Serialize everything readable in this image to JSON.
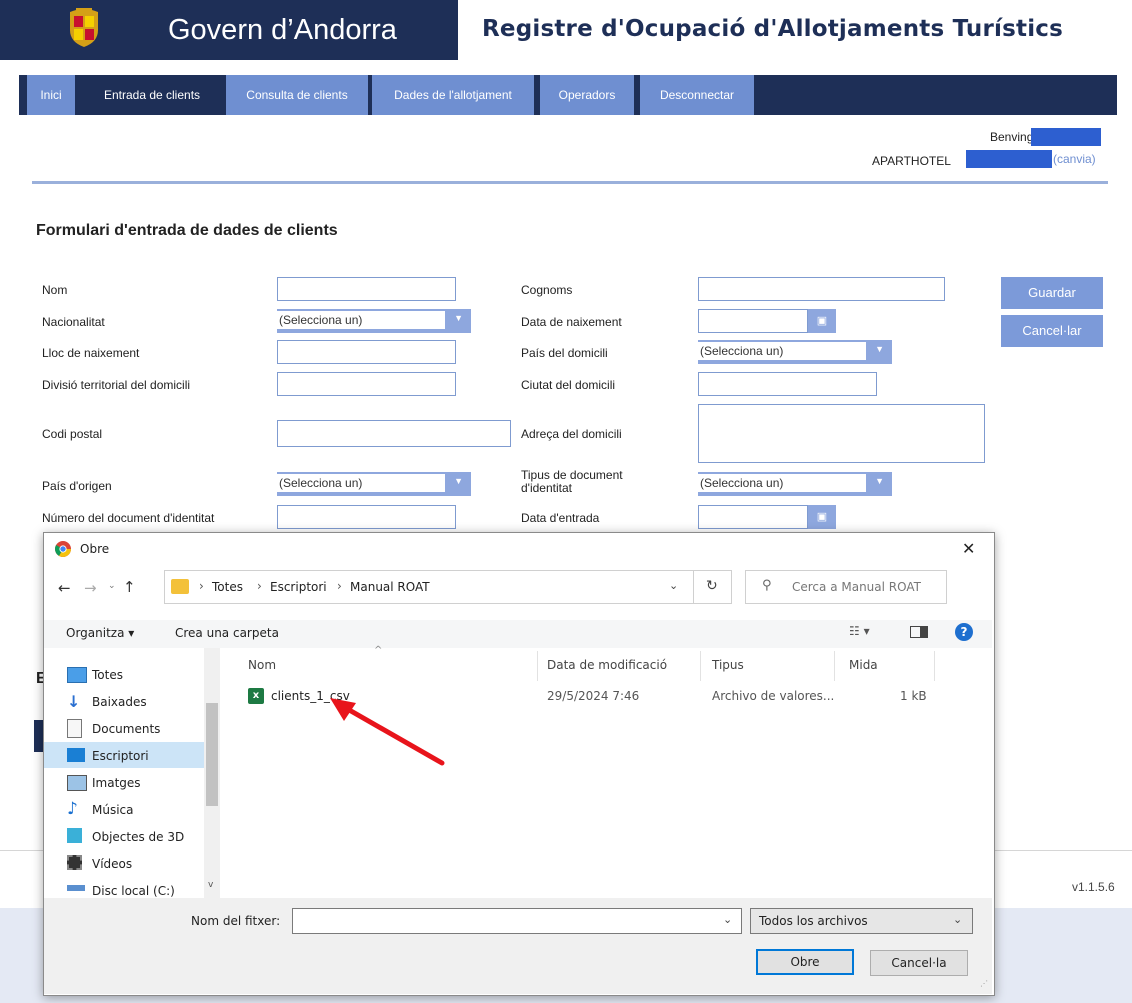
{
  "header": {
    "gov_name": "Govern d’Andorra",
    "app_title": "Registre d'Ocupació d'Allotjaments Turístics"
  },
  "nav": {
    "items": [
      "Inici",
      "Entrada de clients",
      "Consulta de clients",
      "Dades de l'allotjament",
      "Operadors",
      "Desconnectar"
    ]
  },
  "user": {
    "welcome": "Benvingut,",
    "hotel_label": "APARTHOTEL",
    "change_link": "(canvia)"
  },
  "form": {
    "title": "Formulari d'entrada de dades de clients",
    "labels": {
      "nom": "Nom",
      "nacionalitat": "Nacionalitat",
      "lloc_naixement": "Lloc de naixement",
      "divisio": "Divisió territorial del domicili",
      "codi_postal": "Codi postal",
      "pais_origen": "País d'origen",
      "num_document": "Número del document d'identitat",
      "cognoms": "Cognoms",
      "data_naixement": "Data de naixement",
      "pais_domicili": "País del domicili",
      "ciutat": "Ciutat del domicili",
      "adreca": "Adreça del domicili",
      "tipus_document": "Tipus de document d'identitat",
      "data_entrada": "Data d'entrada"
    },
    "select_placeholder": "(Selecciona un)",
    "save_label": "Guardar",
    "cancel_label": "Cancel·lar",
    "partial_heading": "E"
  },
  "footer": {
    "version": "v1.1.5.6"
  },
  "dialog": {
    "title": "Obre",
    "close": "✕",
    "breadcrumb": [
      "Totes",
      "Escriptori",
      "Manual ROAT"
    ],
    "search_placeholder": "Cerca a Manual ROAT",
    "organize_label": "Organitza ▾",
    "new_folder_label": "Crea una carpeta",
    "columns": [
      "Nom",
      "Data de modificació",
      "Tipus",
      "Mida"
    ],
    "file": {
      "name": "clients_1_csv",
      "modified": "29/5/2024 7:46",
      "type": "Archivo de valores...",
      "size": "1 kB"
    },
    "nav_items": [
      {
        "label": "Totes",
        "icon": "computer-icon"
      },
      {
        "label": "Baixades",
        "icon": "download-arrow-icon"
      },
      {
        "label": "Documents",
        "icon": "document-icon"
      },
      {
        "label": "Escriptori",
        "icon": "desktop-icon"
      },
      {
        "label": "Imatges",
        "icon": "image-icon"
      },
      {
        "label": "Música",
        "icon": "music-note-icon"
      },
      {
        "label": "Objectes de 3D",
        "icon": "cube-icon"
      },
      {
        "label": "Vídeos",
        "icon": "film-icon"
      },
      {
        "label": "Disc local (C:)",
        "icon": "drive-icon"
      }
    ],
    "filename_label": "Nom del fitxer:",
    "filename_value": "",
    "filter_value": "Todos los archivos",
    "open_label": "Obre",
    "cancel_label": "Cancel·la"
  },
  "colors": {
    "brand_navy": "#1e2f57",
    "nav_active": "#6f8fd1",
    "button_blue": "#7c9ad9",
    "redaction": "#2d5fd0",
    "annotation_arrow": "#e8141b"
  }
}
